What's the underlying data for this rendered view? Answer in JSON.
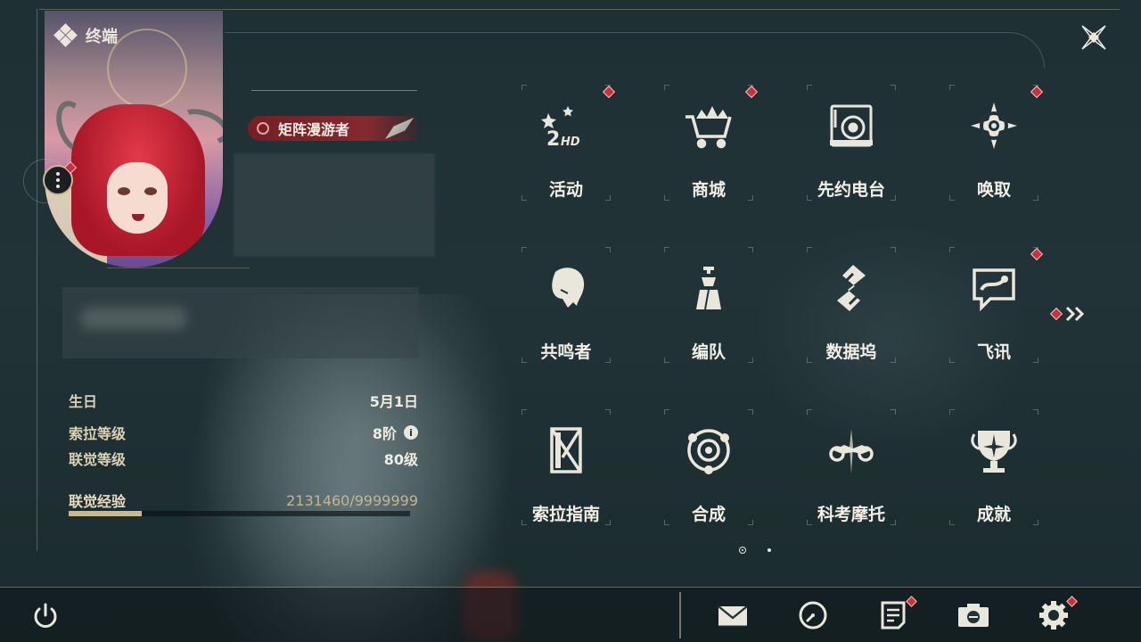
{
  "header": {
    "title": "终端",
    "close_icon": "close-x-icon"
  },
  "profile": {
    "title_tag": "矩阵漫游者",
    "stats": [
      {
        "label": "生日",
        "value": "5月1日"
      },
      {
        "label": "索拉等级",
        "value": "8阶"
      },
      {
        "label": "联觉等级",
        "value": "80级"
      }
    ],
    "exp": {
      "label": "联觉经验",
      "value": "2131460/9999999",
      "current": 2131460,
      "max": 9999999
    }
  },
  "menu": {
    "items": [
      {
        "label": "活动",
        "icon": "activity-2hd-icon",
        "badge": true
      },
      {
        "label": "商城",
        "icon": "shop-cart-icon",
        "badge": true
      },
      {
        "label": "先约电台",
        "icon": "radio-turntable-icon",
        "badge": false
      },
      {
        "label": "唤取",
        "icon": "convene-compass-icon",
        "badge": true
      },
      {
        "label": "共鸣者",
        "icon": "resonator-head-icon",
        "badge": false
      },
      {
        "label": "编队",
        "icon": "team-chess-icon",
        "badge": false
      },
      {
        "label": "数据坞",
        "icon": "data-dock-icon",
        "badge": false
      },
      {
        "label": "飞讯",
        "icon": "message-bubble-icon",
        "badge": true
      },
      {
        "label": "索拉指南",
        "icon": "guide-book-icon",
        "badge": false
      },
      {
        "label": "合成",
        "icon": "synthesis-orbit-icon",
        "badge": false
      },
      {
        "label": "科考摩托",
        "icon": "motorcycle-icon",
        "badge": false
      },
      {
        "label": "成就",
        "icon": "achievement-trophy-icon",
        "badge": false
      }
    ],
    "pages": 2,
    "current_page": 1
  },
  "footer": {
    "buttons": [
      {
        "name": "mail",
        "icon": "mail-icon",
        "badge": false
      },
      {
        "name": "clock",
        "icon": "clock-icon",
        "badge": false
      },
      {
        "name": "notes",
        "icon": "notes-icon",
        "badge": true
      },
      {
        "name": "camera",
        "icon": "camera-icon",
        "badge": false
      },
      {
        "name": "settings",
        "icon": "gear-icon",
        "badge": true
      }
    ]
  },
  "colors": {
    "accent": "#c9b98c",
    "badge": "#c8323b",
    "background": "#213337"
  }
}
